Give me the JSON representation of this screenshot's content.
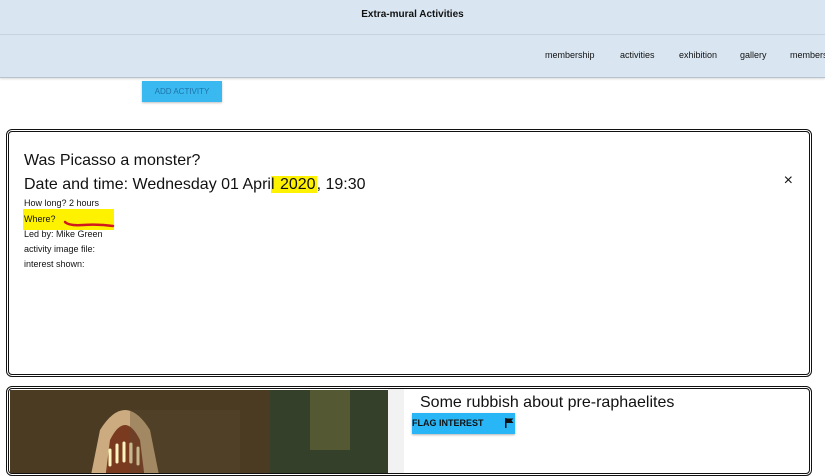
{
  "app": {
    "title": "Extra-mural Activities"
  },
  "nav": {
    "items": [
      {
        "label": "membership"
      },
      {
        "label": "activities"
      },
      {
        "label": "exhibition"
      },
      {
        "label": "gallery"
      },
      {
        "label": "members"
      }
    ]
  },
  "toolbar": {
    "add_label": "ADD ACTIVITY"
  },
  "activity1": {
    "title": "Was Picasso a monster?",
    "date_prefix": "Date and time: Wednesday 01 Apri",
    "date_hl_l": "l",
    "date_gap": " ",
    "date_year": "2020",
    "date_suffix": ", 19:30",
    "close": "×",
    "how_long": "How long? 2 hours",
    "where": "Where?",
    "led_by": "Led by: Mike Green",
    "image_file": "activity image file:",
    "interest": "interest shown:"
  },
  "activity2": {
    "title": "Some rubbish about pre-raphaelites",
    "flag_label": "FLAG INTEREST"
  },
  "colors": {
    "appbar": "#d9e6f2",
    "accent": "#29b6f6",
    "highlight": "#fff200",
    "annotation": "#d0191e"
  },
  "icons": {
    "close": "close-icon",
    "flag": "flag-icon"
  }
}
